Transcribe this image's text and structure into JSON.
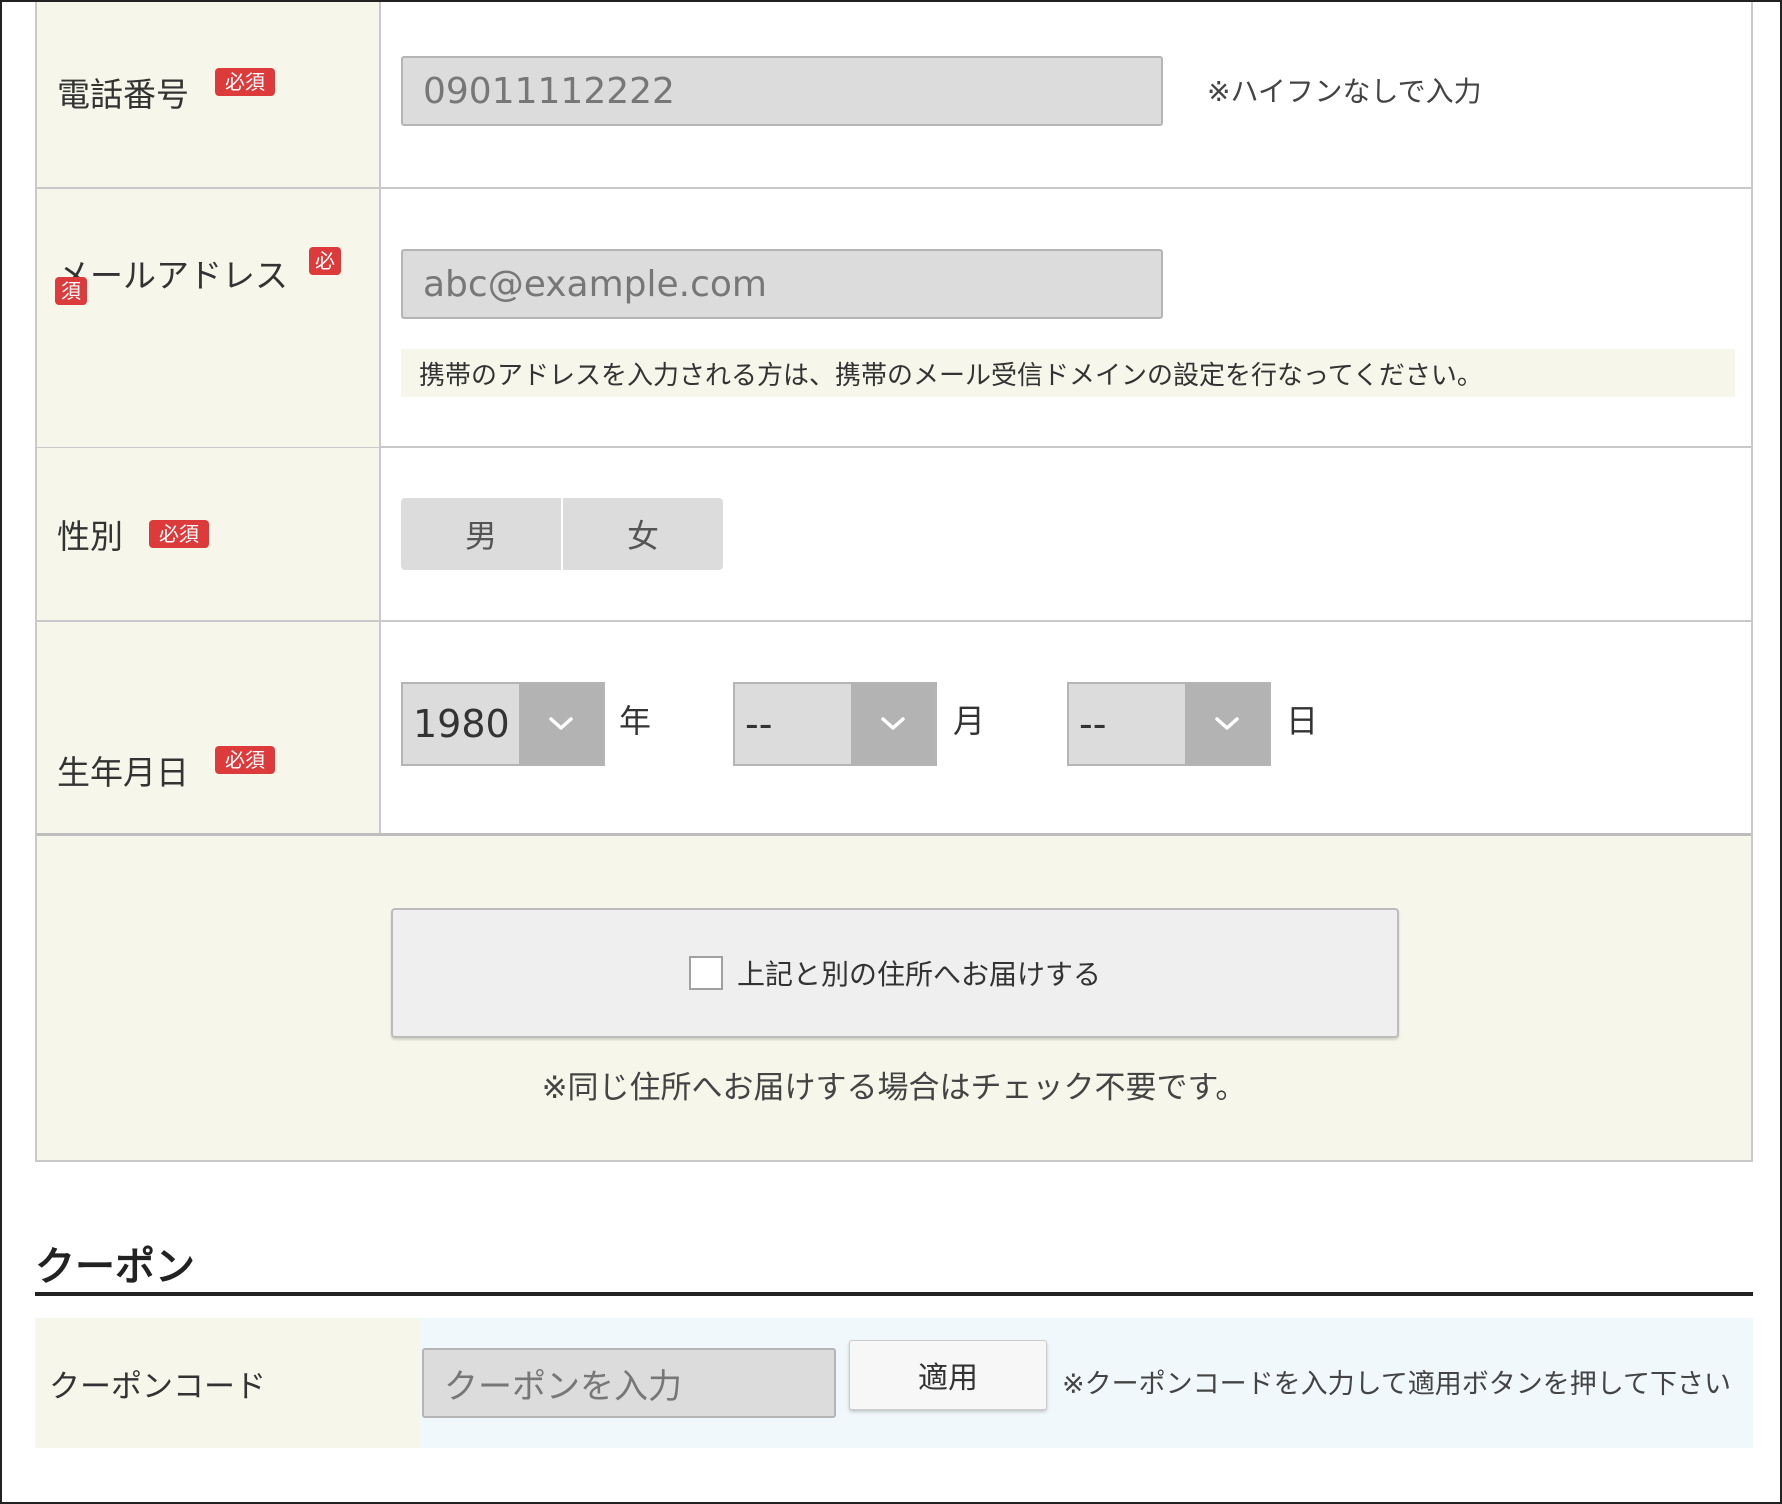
{
  "form": {
    "badge_required": "必須",
    "phone": {
      "label": "電話番号",
      "value": "09011112222",
      "note": "※ハイフンなしで入力"
    },
    "email": {
      "label": "メールアドレス",
      "badge_part1": "必",
      "badge_part2": "須",
      "value": "abc@example.com",
      "notice": "携帯のアドレスを入力される方は、携帯のメール受信ドメインの設定を行なってください。"
    },
    "gender": {
      "label": "性別",
      "options": [
        "男",
        "女"
      ]
    },
    "birthday": {
      "label": "生年月日",
      "year": "1980",
      "month": "--",
      "day": "--",
      "year_unit": "年",
      "month_unit": "月",
      "day_unit": "日"
    }
  },
  "delivery": {
    "checkbox_label": "上記と別の住所へお届けする",
    "checked": false,
    "note": "※同じ住所へお届けする場合はチェック不要です。"
  },
  "coupon": {
    "title": "クーポン",
    "label": "クーポンコード",
    "placeholder": "クーポンを入力",
    "apply_label": "適用",
    "note": "※クーポンコードを入力して適用ボタンを押して下さい"
  },
  "colors": {
    "label_bg": "#f6f7ea",
    "badge": "#dd3b3b",
    "input_bg": "#dcdcdc",
    "coupon_bg": "#f1f8fb"
  }
}
